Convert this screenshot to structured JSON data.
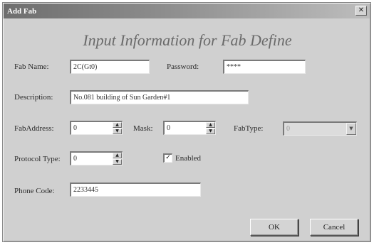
{
  "window": {
    "title": "Add Fab",
    "close_glyph": "✕"
  },
  "heading": "Input Information for Fab Define",
  "form": {
    "fab_name": {
      "label": "Fab Name:",
      "value": "2C(Gt0)"
    },
    "password": {
      "label": "Password:",
      "value": "****"
    },
    "description": {
      "label": "Description:",
      "value": "No.081 building of Sun Garden#1"
    },
    "fab_address": {
      "label": "FabAddress:",
      "value": "0"
    },
    "mask": {
      "label": "Mask:",
      "value": "0"
    },
    "fab_type": {
      "label": "FabType:",
      "value": "0"
    },
    "protocol_type": {
      "label": "Protocol Type:",
      "value": "0"
    },
    "enabled": {
      "label": "Enabled",
      "checked": true,
      "check_glyph": "✓"
    },
    "phone_code": {
      "label": "Phone Code:",
      "value": "2233445"
    }
  },
  "buttons": {
    "ok": "OK",
    "cancel": "Cancel"
  },
  "icons": {
    "spin_up": "▲",
    "spin_down": "▼",
    "dropdown": "▼"
  }
}
